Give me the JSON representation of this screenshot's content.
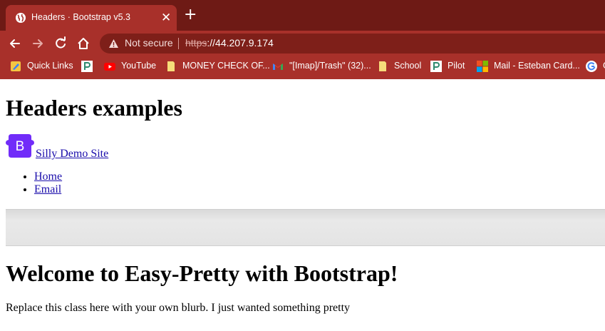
{
  "browser": {
    "tab": {
      "title": "Headers · Bootstrap v5.3",
      "close": "✕",
      "icon": "globe-icon"
    },
    "new_tab": "+",
    "toolbar": {
      "security_label": "Not secure",
      "url_scheme": "https",
      "url_rest": "://44.207.9.174"
    },
    "bookmarks": [
      {
        "label": "Quick Links",
        "icon": "pencil-icon"
      },
      {
        "label": "",
        "icon": "p-icon"
      },
      {
        "label": "YouTube",
        "icon": "youtube-icon"
      },
      {
        "label": "MONEY CHECK OF...",
        "icon": "note-icon"
      },
      {
        "label": "\"[Imap]/Trash\" (32)...",
        "icon": "gmail-icon"
      },
      {
        "label": "School",
        "icon": "note-icon"
      },
      {
        "label": "Pilot",
        "icon": "p-icon"
      },
      {
        "label": "Mail - Esteban Card...",
        "icon": "microsoft-icon"
      },
      {
        "label": "G",
        "icon": "google-icon"
      }
    ]
  },
  "page": {
    "heading": "Headers examples",
    "brand_text": " Silly Demo Site",
    "brand_logo_letter": "B",
    "nav": [
      "Home",
      "Email"
    ],
    "welcome": "Welcome to Easy-Pretty with Bootstrap!",
    "blurb": "Replace this class here with your own blurb. I just wanted something pretty"
  },
  "colors": {
    "tab_strip": "#6e1a15",
    "toolbar": "#a8302a",
    "omnibox": "#7e1f19",
    "bootstrap_purple": "#712cf9",
    "link": "#1a0dab"
  }
}
